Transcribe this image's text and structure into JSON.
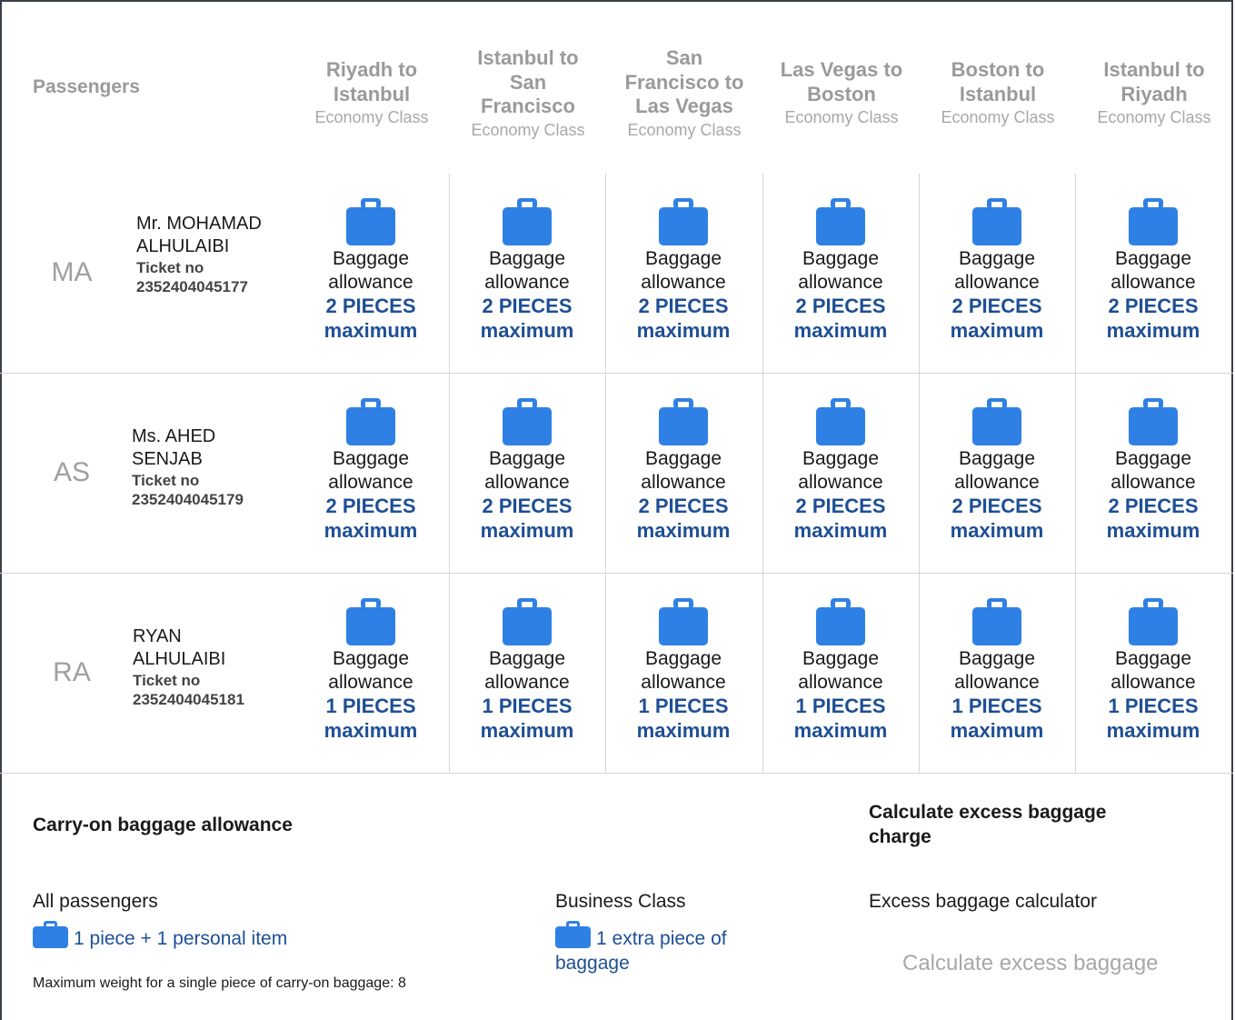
{
  "header": {
    "passengers_label": "Passengers"
  },
  "segments": [
    {
      "route": "Riyadh to Istanbul",
      "class": "Economy Class"
    },
    {
      "route": "Istanbul to San Francisco",
      "class": "Economy Class"
    },
    {
      "route": "San Francisco to Las Vegas",
      "class": "Economy Class"
    },
    {
      "route": "Las Vegas to Boston",
      "class": "Economy Class"
    },
    {
      "route": "Boston to Istanbul",
      "class": "Economy Class"
    },
    {
      "route": "Istanbul to Riyadh",
      "class": "Economy Class"
    }
  ],
  "passengers": [
    {
      "initials": "MA",
      "name": "Mr. MOHAMAD ALHULAIBI",
      "ticket_label": "Ticket no",
      "ticket_no": "2352404045177",
      "allowance_label": "Baggage allowance",
      "allowance_value": "2 PIECES maximum"
    },
    {
      "initials": "AS",
      "name": "Ms. AHED SENJAB",
      "ticket_label": "Ticket no",
      "ticket_no": "2352404045179",
      "allowance_label": "Baggage allowance",
      "allowance_value": "2 PIECES maximum"
    },
    {
      "initials": "RA",
      "name": "RYAN ALHULAIBI",
      "ticket_label": "Ticket no",
      "ticket_no": "2352404045181",
      "allowance_label": "Baggage allowance",
      "allowance_value": "1 PIECES maximum"
    }
  ],
  "carry_on": {
    "title": "Carry-on baggage allowance",
    "all_passengers_label": "All passengers",
    "all_passengers_value": "1 piece + 1 personal item",
    "business_label": "Business Class",
    "business_value": "1 extra piece of baggage",
    "max_weight_note": "Maximum weight for a single piece of carry-on baggage: 8"
  },
  "excess": {
    "title": "Calculate excess baggage charge",
    "calculator_label": "Excess baggage calculator",
    "button_label": "Calculate excess baggage"
  },
  "colors": {
    "accent": "#2f80e4",
    "link": "#1e4f95",
    "muted": "#9a9a9a"
  },
  "icons": {
    "baggage": "suitcase-icon"
  }
}
